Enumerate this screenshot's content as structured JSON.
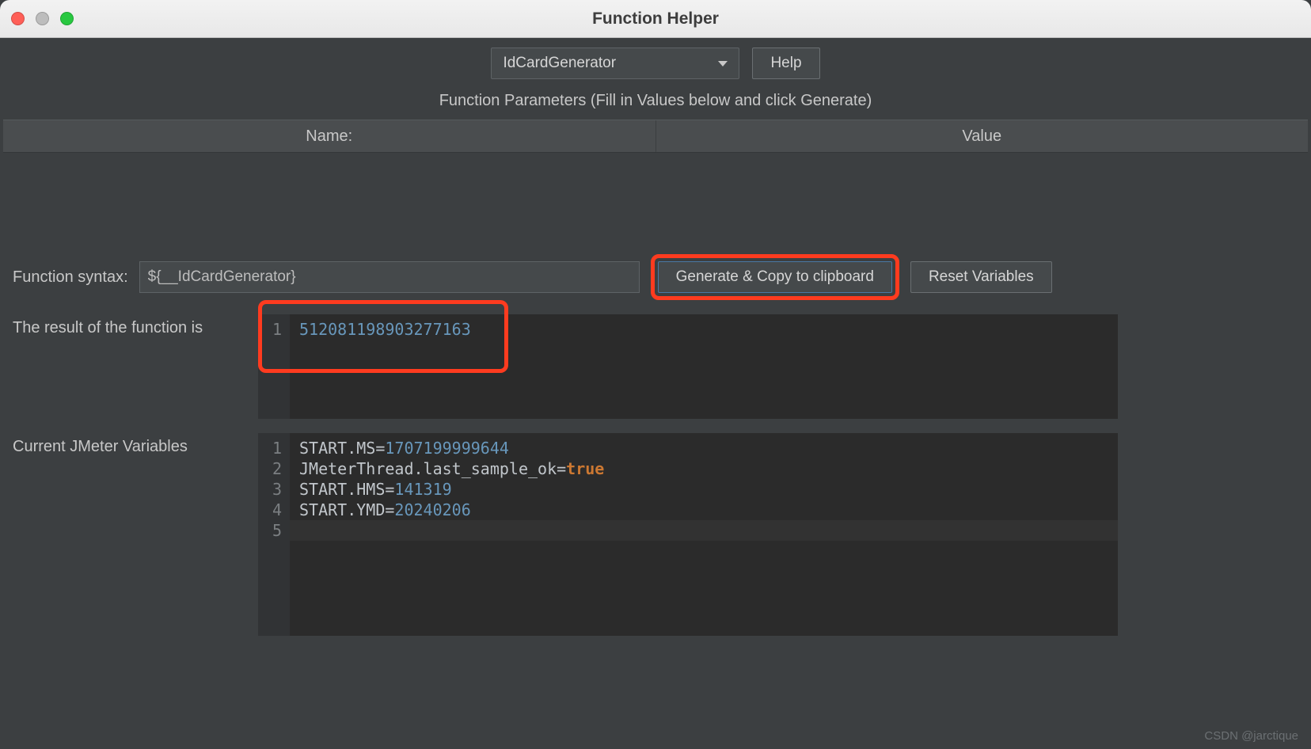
{
  "window": {
    "title": "Function Helper"
  },
  "toolbar": {
    "selector_value": "IdCardGenerator",
    "help_label": "Help"
  },
  "params": {
    "heading": "Function Parameters (Fill in Values below and click Generate)",
    "col_name": "Name:",
    "col_value": "Value"
  },
  "syntax": {
    "label": "Function syntax:",
    "value": "${__IdCardGenerator}",
    "generate_label": "Generate & Copy to clipboard",
    "reset_label": "Reset Variables"
  },
  "result": {
    "label": "The result of the function is",
    "gutter": [
      "1"
    ],
    "lines": [
      {
        "num": "512081198903277163"
      }
    ]
  },
  "vars": {
    "label": "Current JMeter Variables",
    "gutter": [
      "1",
      "2",
      "3",
      "4",
      "5"
    ],
    "lines": [
      {
        "key": "START.MS",
        "num": "1707199999644"
      },
      {
        "key": "JMeterThread.last_sample_ok",
        "bool": "true"
      },
      {
        "key": "START.HMS",
        "num": "141319"
      },
      {
        "key": "START.YMD",
        "num": "20240206"
      },
      {
        "empty": true
      }
    ]
  },
  "watermark": "CSDN @jarctique"
}
